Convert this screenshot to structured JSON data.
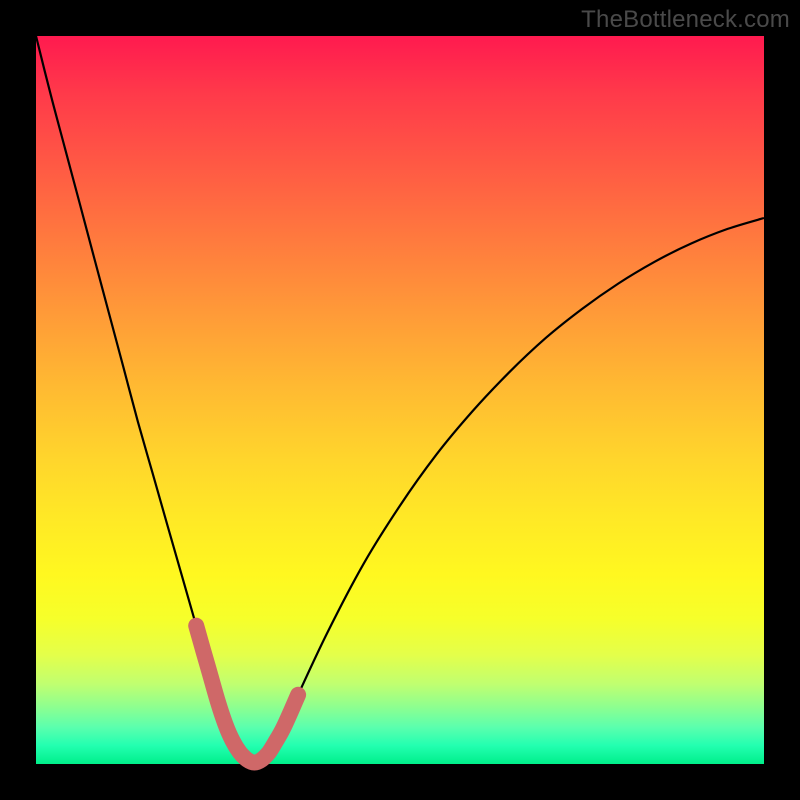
{
  "watermark": "TheBottleneck.com",
  "chart_data": {
    "type": "line",
    "title": "",
    "xlabel": "",
    "ylabel": "",
    "xlim": [
      0,
      100
    ],
    "ylim": [
      0,
      100
    ],
    "grid": false,
    "series": [
      {
        "name": "bottleneck-curve",
        "color": "#000000",
        "x": [
          0,
          2,
          4,
          6,
          8,
          10,
          12,
          14,
          16,
          18,
          20,
          22,
          24,
          25,
          26,
          27,
          28,
          29,
          30,
          31,
          32,
          34,
          36,
          40,
          45,
          50,
          55,
          60,
          65,
          70,
          75,
          80,
          85,
          90,
          95,
          100
        ],
        "y": [
          100,
          92,
          84.5,
          77,
          69.5,
          62,
          54.5,
          47,
          40,
          33,
          26,
          19,
          12,
          8.5,
          5.5,
          3.2,
          1.6,
          0.6,
          0.2,
          0.6,
          1.6,
          5,
          9.5,
          18,
          27.5,
          35.5,
          42.5,
          48.5,
          53.8,
          58.5,
          62.5,
          66,
          69,
          71.5,
          73.5,
          75
        ]
      },
      {
        "name": "bottleneck-highlight",
        "color": "#d46a6a",
        "x": [
          22,
          23,
          24,
          25,
          26,
          27,
          28,
          29,
          30,
          31,
          32,
          33,
          34,
          35,
          36
        ],
        "y": [
          19,
          15.5,
          12,
          8.5,
          5.5,
          3.2,
          1.6,
          0.6,
          0.2,
          0.6,
          1.6,
          3.2,
          5.0,
          7.2,
          9.5
        ]
      }
    ]
  }
}
